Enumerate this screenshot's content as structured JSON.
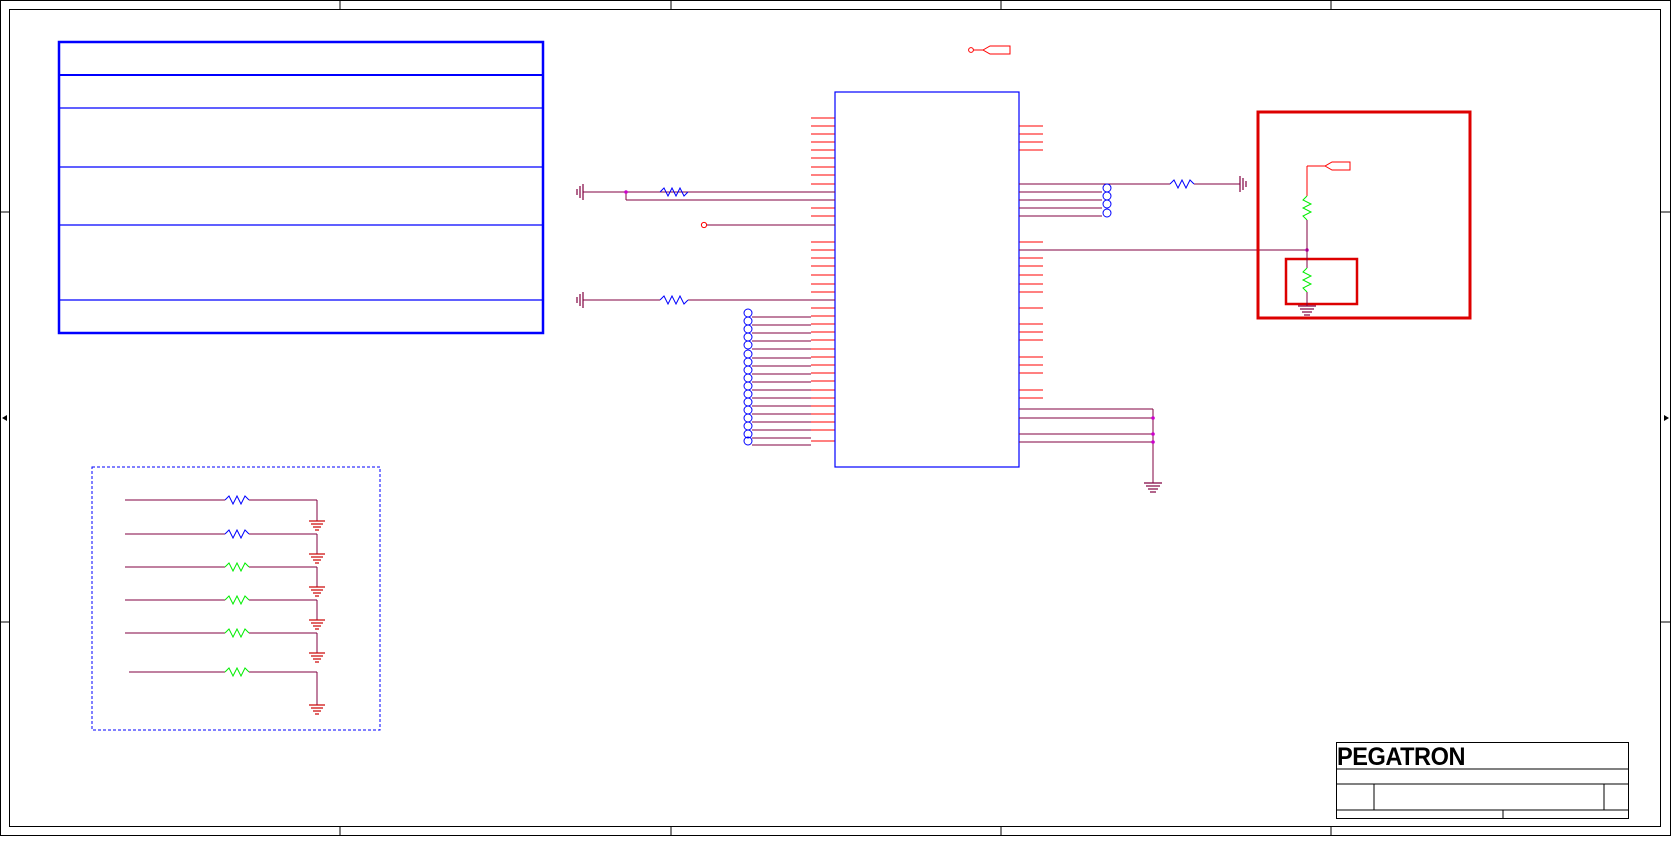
{
  "logo": {
    "text": "PEGATRON"
  },
  "colors": {
    "border": "#000000",
    "note_box": "#0000ff",
    "ic_body": "#0000ff",
    "pin": "#ff0000",
    "net": "#800040",
    "junction": "#cc00cc",
    "resistor": "#0000ff",
    "resistor_dnp": "#00ee00",
    "ground": "#cc0000",
    "highlight": "#dd0000",
    "group_box": "#0000ff"
  },
  "icons": {
    "ground": "ground-symbol-icon",
    "resistor": "resistor-icon",
    "offpage": "offpage-connector-icon",
    "testpoint": "test-point-icon",
    "logo": "pegatron-logo"
  }
}
